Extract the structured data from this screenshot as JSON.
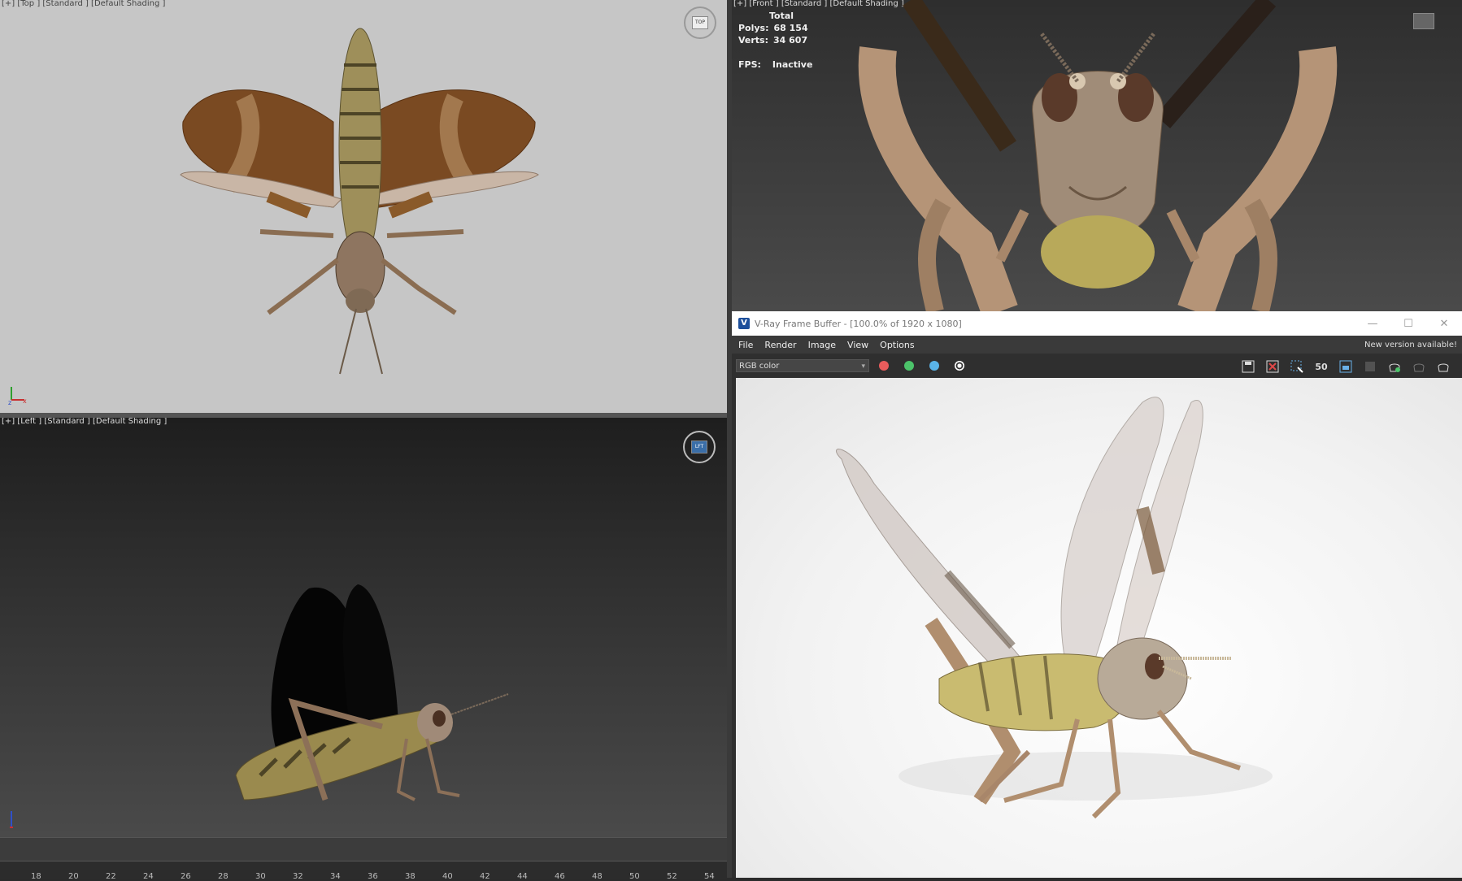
{
  "viewports": {
    "top": {
      "label": "[+] [Top ] [Standard ] [Default Shading ]"
    },
    "front": {
      "label": "[+] [Front ] [Standard ] [Default Shading ]"
    },
    "left": {
      "label": "[+] [Left ] [Standard ] [Default Shading ]"
    }
  },
  "stats": {
    "total_label": "Total",
    "polys_label": "Polys:",
    "polys_value": "68 154",
    "verts_label": "Verts:",
    "verts_value": "34 607",
    "fps_label": "FPS:",
    "fps_value": "Inactive"
  },
  "timeline": {
    "ticks": [
      "18",
      "20",
      "22",
      "24",
      "26",
      "28",
      "30",
      "32",
      "34",
      "36",
      "38",
      "40",
      "42",
      "44",
      "46",
      "48",
      "50",
      "52",
      "54"
    ]
  },
  "vfb": {
    "title": "V-Ray Frame Buffer - [100.0% of 1920 x 1080]",
    "menu": [
      "File",
      "Render",
      "Image",
      "View",
      "Options"
    ],
    "notice": "New version available!",
    "channel_select": "RGB color",
    "colors": {
      "red": "#e85c5c",
      "green": "#4cc36a",
      "blue": "#5ab4e8"
    },
    "zoom_icon_text": "50"
  },
  "icons": [
    "save-icon",
    "clear-icon",
    "region-icon",
    "zoom-icon",
    "frame-icon",
    "teapot-render-icon",
    "close-icon",
    "maximize-icon",
    "minimize-icon",
    "vray-logo-icon",
    "viewcube-icon",
    "axis-gizmo-icon"
  ]
}
